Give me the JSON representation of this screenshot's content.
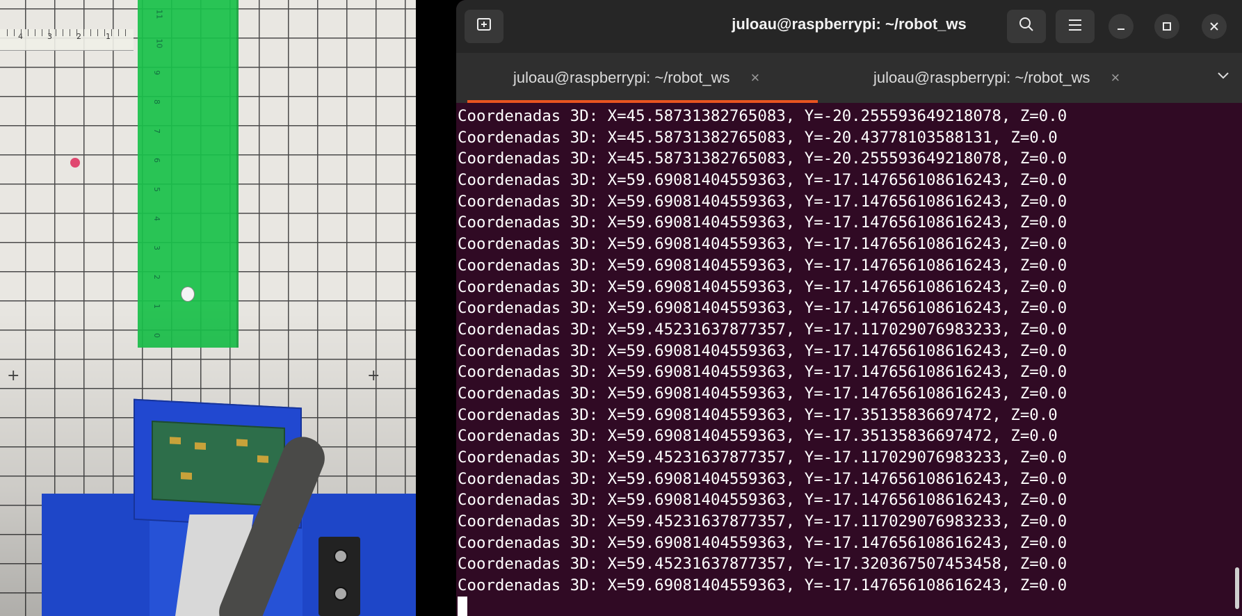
{
  "terminal": {
    "title": "juloau@raspberrypi: ~/robot_ws",
    "new_tab_icon": "new-tab-icon",
    "tabs": [
      {
        "label": "juloau@raspberrypi: ~/robot_ws",
        "active": true
      },
      {
        "label": "juloau@raspberrypi: ~/robot_ws",
        "active": false
      }
    ],
    "tab_close_glyph": "×",
    "accent": "#e95420",
    "background": "#300a24",
    "lines": [
      "Coordenadas 3D: X=45.5873138276 5083, Y=-20.255593649218078, Z=0.0",
      "Coordenadas 3D: X=45.5873138276 5083, Y=-20.43778103588131, Z=0.0",
      "Coordenadas 3D: X=45.5873138276 5083, Y=-20.255593649218078, Z=0.0",
      "Coordenadas 3D: X=59.69081404559363, Y=-17.14765610861 6243, Z=0.0",
      "Coordenadas 3D: X=59.69081404559363, Y=-17.14765610861 6243, Z=0.0",
      "Coordenadas 3D: X=59.69081404559363, Y=-17.14765610861 6243, Z=0.0",
      "Coordenadas 3D: X=59.69081404559363, Y=-17.14765610861 6243, Z=0.0",
      "Coordenadas 3D: X=59.69081404559363, Y=-17.14765610861 6243, Z=0.0",
      "Coordenadas 3D: X=59.69081404559363, Y=-17.14765610861 6243, Z=0.0",
      "Coordenadas 3D: X=59.69081404559363, Y=-17.14765610861 6243, Z=0.0",
      "Coordenadas 3D: X=59.4523163787 7357, Y=-17.11702907698 3233, Z=0.0",
      "Coordenadas 3D: X=59.69081404559363, Y=-17.14765610861 6243, Z=0.0",
      "Coordenadas 3D: X=59.69081404559363, Y=-17.14765610861 6243, Z=0.0",
      "Coordenadas 3D: X=59.69081404559363, Y=-17.14765610861 6243, Z=0.0",
      "Coordenadas 3D: X=59.69081404559363, Y=-17.35135836697472, Z=0.0",
      "Coordenadas 3D: X=59.69081404559363, Y=-17.35135836697472, Z=0.0",
      "Coordenadas 3D: X=59.4523163787 7357, Y=-17.11702907698 3233, Z=0.0",
      "Coordenadas 3D: X=59.69081404559363, Y=-17.14765610861 6243, Z=0.0",
      "Coordenadas 3D: X=59.69081404559363, Y=-17.14765610861 6243, Z=0.0",
      "Coordenadas 3D: X=59.4523163787 7357, Y=-17.11702907698 3233, Z=0.0",
      "Coordenadas 3D: X=59.69081404559363, Y=-17.14765610861 6243, Z=0.0",
      "Coordenadas 3D: X=59.4523163787 7357, Y=-17.32036750745 3458, Z=0.0",
      "Coordenadas 3D: X=59.69081404559363, Y=-17.14765610861 6243, Z=0.0"
    ]
  },
  "camera": {
    "ruler_numbers": [
      "4",
      "3",
      "2",
      "1"
    ],
    "green_ruler_numbers": [
      "11",
      "10",
      "9",
      "8",
      "7",
      "6",
      "5",
      "4",
      "3",
      "2",
      "1",
      "0"
    ]
  }
}
